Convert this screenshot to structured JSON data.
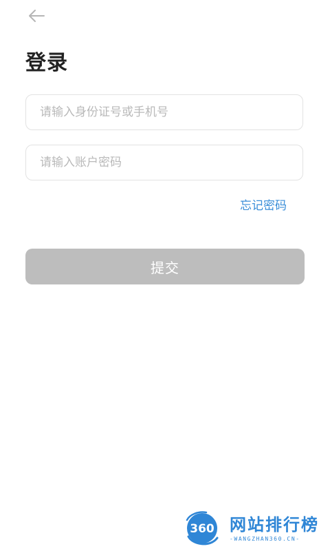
{
  "header": {
    "back_icon": "arrow-left-icon",
    "title": "登录"
  },
  "form": {
    "id_field": {
      "value": "",
      "placeholder": "请输入身份证号或手机号"
    },
    "password_field": {
      "value": "",
      "placeholder": "请输入账户密码"
    },
    "forgot_label": "忘记密码",
    "submit_label": "提交"
  },
  "watermark": {
    "logo_text": "360",
    "title": "网站排行榜",
    "subtitle": "-WANGZHAN360.CN-"
  },
  "colors": {
    "link": "#3a8ed8",
    "button_disabled": "#bdbdbd",
    "watermark": "#2f86d6"
  }
}
